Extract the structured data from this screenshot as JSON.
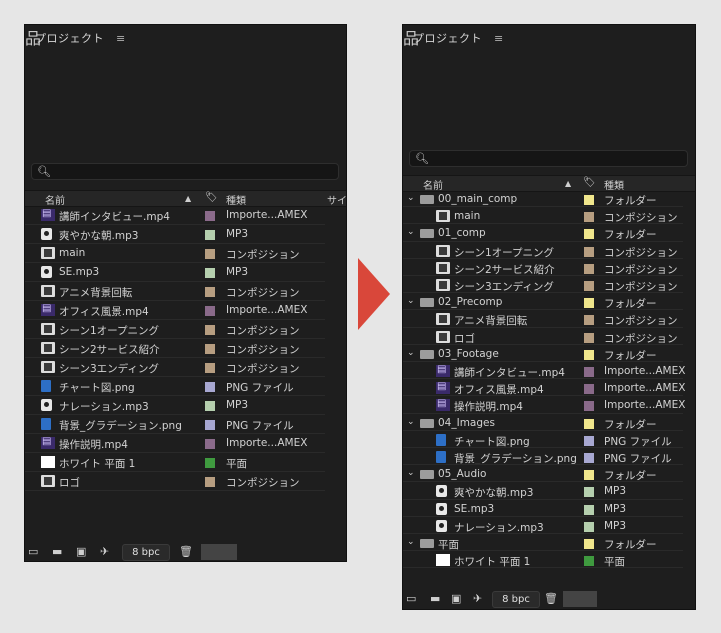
{
  "left": {
    "title": "プロジェクト",
    "menu_glyph": "≡",
    "search_glyph": "🔍︎",
    "headers": {
      "name": "名前",
      "type": "種類",
      "size": "サイ"
    },
    "rows": [
      {
        "name": "講師インタビュー.mp4",
        "icon": "video-icon",
        "label": "#8a6a8a",
        "type": "Importe...AMEX"
      },
      {
        "name": "爽やかな朝.mp3",
        "icon": "audio-icon",
        "label": "#b5cfae",
        "type": "MP3"
      },
      {
        "name": "main",
        "icon": "composition-icon",
        "label": "#b79e81",
        "type": "コンポジション"
      },
      {
        "name": "SE.mp3",
        "icon": "audio-icon",
        "label": "#b5cfae",
        "type": "MP3"
      },
      {
        "name": "アニメ背景回転",
        "icon": "composition-icon",
        "label": "#b79e81",
        "type": "コンポジション"
      },
      {
        "name": "オフィス風景.mp4",
        "icon": "video-icon",
        "label": "#8a6a8a",
        "type": "Importe...AMEX"
      },
      {
        "name": "シーン1オープニング",
        "icon": "composition-icon",
        "label": "#b79e81",
        "type": "コンポジション"
      },
      {
        "name": "シーン2サービス紹介",
        "icon": "composition-icon",
        "label": "#b79e81",
        "type": "コンポジション"
      },
      {
        "name": "シーン3エンディング",
        "icon": "composition-icon",
        "label": "#b79e81",
        "type": "コンポジション"
      },
      {
        "name": "チャート図.png",
        "icon": "image-icon",
        "label": "#a8a8d2",
        "type": "PNG ファイル"
      },
      {
        "name": "ナレーション.mp3",
        "icon": "audio-icon",
        "label": "#b5cfae",
        "type": "MP3"
      },
      {
        "name": "背景_グラデーション.png",
        "icon": "image-icon",
        "label": "#a8a8d2",
        "type": "PNG ファイル"
      },
      {
        "name": "操作説明.mp4",
        "icon": "video-icon",
        "label": "#8a6a8a",
        "type": "Importe...AMEX"
      },
      {
        "name": "ホワイト 平面 1",
        "icon": "solid-icon",
        "label": "#3f9a3f",
        "type": "平面"
      },
      {
        "name": "ロゴ",
        "icon": "composition-icon",
        "label": "#b79e81",
        "type": "コンポジション"
      }
    ],
    "bpc": "8 bpc"
  },
  "right": {
    "title": "プロジェクト",
    "menu_glyph": "≡",
    "search_glyph": "🔍︎",
    "headers": {
      "name": "名前",
      "type": "種類"
    },
    "rows": [
      {
        "name": "00_main_comp",
        "icon": "folder-icon",
        "label": "#f0e68c",
        "type": "フォルダー",
        "folder": true
      },
      {
        "name": "main",
        "icon": "composition-icon",
        "label": "#b79e81",
        "type": "コンポジション"
      },
      {
        "name": "01_comp",
        "icon": "folder-icon",
        "label": "#f0e68c",
        "type": "フォルダー",
        "folder": true
      },
      {
        "name": "シーン1オープニング",
        "icon": "composition-icon",
        "label": "#b79e81",
        "type": "コンポジション"
      },
      {
        "name": "シーン2サービス紹介",
        "icon": "composition-icon",
        "label": "#b79e81",
        "type": "コンポジション"
      },
      {
        "name": "シーン3エンディング",
        "icon": "composition-icon",
        "label": "#b79e81",
        "type": "コンポジション"
      },
      {
        "name": "02_Precomp",
        "icon": "folder-icon",
        "label": "#f0e68c",
        "type": "フォルダー",
        "folder": true
      },
      {
        "name": "アニメ背景回転",
        "icon": "composition-icon",
        "label": "#b79e81",
        "type": "コンポジション"
      },
      {
        "name": "ロゴ",
        "icon": "composition-icon",
        "label": "#b79e81",
        "type": "コンポジション"
      },
      {
        "name": "03_Footage",
        "icon": "folder-icon",
        "label": "#f0e68c",
        "type": "フォルダー",
        "folder": true
      },
      {
        "name": "講師インタビュー.mp4",
        "icon": "video-icon",
        "label": "#8a6a8a",
        "type": "Importe...AMEX"
      },
      {
        "name": "オフィス風景.mp4",
        "icon": "video-icon",
        "label": "#8a6a8a",
        "type": "Importe...AMEX"
      },
      {
        "name": "操作説明.mp4",
        "icon": "video-icon",
        "label": "#8a6a8a",
        "type": "Importe...AMEX"
      },
      {
        "name": "04_Images",
        "icon": "folder-icon",
        "label": "#f0e68c",
        "type": "フォルダー",
        "folder": true
      },
      {
        "name": "チャート図.png",
        "icon": "image-icon",
        "label": "#a8a8d2",
        "type": "PNG ファイル"
      },
      {
        "name": "背景_グラデーション.png",
        "icon": "image-icon",
        "label": "#a8a8d2",
        "type": "PNG ファイル"
      },
      {
        "name": "05_Audio",
        "icon": "folder-icon",
        "label": "#f0e68c",
        "type": "フォルダー",
        "folder": true
      },
      {
        "name": "爽やかな朝.mp3",
        "icon": "audio-icon",
        "label": "#b5cfae",
        "type": "MP3"
      },
      {
        "name": "SE.mp3",
        "icon": "audio-icon",
        "label": "#b5cfae",
        "type": "MP3"
      },
      {
        "name": "ナレーション.mp3",
        "icon": "audio-icon",
        "label": "#b5cfae",
        "type": "MP3"
      },
      {
        "name": "平面",
        "icon": "folder-icon",
        "label": "#f0e68c",
        "type": "フォルダー",
        "folder": true
      },
      {
        "name": "ホワイト 平面 1",
        "icon": "solid-icon",
        "label": "#3f9a3f",
        "type": "平面"
      }
    ],
    "bpc": "8 bpc"
  },
  "accent_arrow_color": "#d9473a"
}
